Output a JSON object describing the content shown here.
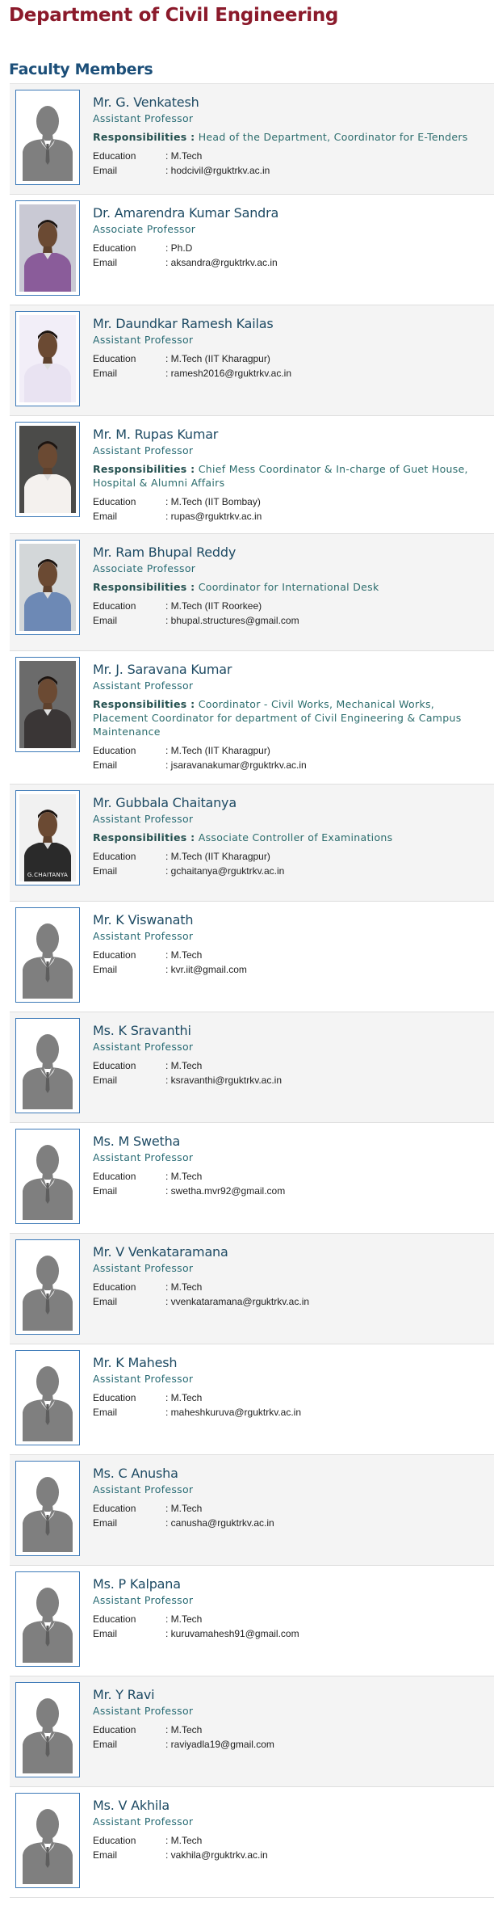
{
  "header": {
    "department_title": "Department of Civil Engineering"
  },
  "section": {
    "title": "Faculty Members"
  },
  "labels": {
    "education": "Education",
    "email": "Email",
    "responsibilities": "Responsibilities :"
  },
  "faculty": [
    {
      "name": "Mr. G. Venkatesh",
      "designation": "Assistant Professor",
      "responsibilities": "Head of the Department, Coordinator for E-Tenders",
      "education": ": M.Tech",
      "email": ": hodcivil@rguktrkv.ac.in",
      "photo": "placeholder-avatar"
    },
    {
      "name": "Dr. Amarendra Kumar Sandra",
      "designation": "Associate Professor",
      "responsibilities": "",
      "education": ": Ph.D",
      "email": ": aksandra@rguktrkv.ac.in",
      "photo": "portrait-photo"
    },
    {
      "name": "Mr. Daundkar Ramesh Kailas",
      "designation": "Assistant Professor",
      "responsibilities": "",
      "education": ": M.Tech (IIT Kharagpur)",
      "email": ": ramesh2016@rguktrkv.ac.in",
      "photo": "portrait-photo"
    },
    {
      "name": "Mr. M. Rupas Kumar",
      "designation": "Assistant Professor",
      "responsibilities": "Chief Mess Coordinator & In-charge of Guet House, Hospital & Alumni Affairs",
      "education": ": M.Tech (IIT Bombay)",
      "email": ": rupas@rguktrkv.ac.in",
      "photo": "portrait-photo"
    },
    {
      "name": "Mr. Ram Bhupal Reddy",
      "designation": "Associate Professor",
      "responsibilities": "Coordinator for International Desk",
      "education": ": M.Tech (IIT Roorkee)",
      "email": ": bhupal.structures@gmail.com",
      "photo": "portrait-photo"
    },
    {
      "name": "Mr. J. Saravana Kumar",
      "designation": "Assistant Professor",
      "responsibilities": "Coordinator - Civil Works, Mechanical Works, Placement Coordinator for department of Civil Engineering & Campus Maintenance",
      "education": ": M.Tech (IIT Kharagpur)",
      "email": ": jsaravanakumar@rguktrkv.ac.in",
      "photo": "portrait-photo"
    },
    {
      "name": "Mr. Gubbala Chaitanya",
      "designation": "Assistant Professor",
      "responsibilities": "Associate Controller of Examinations",
      "education": ": M.Tech (IIT Kharagpur)",
      "email": ": gchaitanya@rguktrkv.ac.in",
      "photo": "portrait-photo",
      "photo_caption": "G.CHAITANYA"
    },
    {
      "name": "Mr. K Viswanath",
      "designation": "Assistant Professor",
      "responsibilities": "",
      "education": ": M.Tech",
      "email": ": kvr.iit@gmail.com",
      "photo": "placeholder-avatar"
    },
    {
      "name": "Ms. K Sravanthi",
      "designation": "Assistant Professor",
      "responsibilities": "",
      "education": ": M.Tech",
      "email": ": ksravanthi@rguktrkv.ac.in",
      "photo": "placeholder-avatar"
    },
    {
      "name": "Ms. M Swetha",
      "designation": "Assistant Professor",
      "responsibilities": "",
      "education": ": M.Tech",
      "email": ": swetha.mvr92@gmail.com",
      "photo": "placeholder-avatar"
    },
    {
      "name": "Mr. V Venkataramana",
      "designation": "Assistant Professor",
      "responsibilities": "",
      "education": ": M.Tech",
      "email": ": vvenkataramana@rguktrkv.ac.in",
      "photo": "placeholder-avatar"
    },
    {
      "name": "Mr. K Mahesh",
      "designation": "Assistant Professor",
      "responsibilities": "",
      "education": ": M.Tech",
      "email": ": maheshkuruva@rguktrkv.ac.in",
      "photo": "placeholder-avatar"
    },
    {
      "name": "Ms. C Anusha",
      "designation": "Assistant Professor",
      "responsibilities": "",
      "education": ": M.Tech",
      "email": ": canusha@rguktrkv.ac.in",
      "photo": "placeholder-avatar"
    },
    {
      "name": "Ms. P Kalpana",
      "designation": "Assistant Professor",
      "responsibilities": "",
      "education": ": M.Tech",
      "email": ": kuruvamahesh91@gmail.com",
      "photo": "placeholder-avatar"
    },
    {
      "name": "Mr. Y Ravi",
      "designation": "Assistant Professor",
      "responsibilities": "",
      "education": ": M.Tech",
      "email": ": raviyadla19@gmail.com",
      "photo": "placeholder-avatar"
    },
    {
      "name": "Ms. V Akhila",
      "designation": "Assistant Professor",
      "responsibilities": "",
      "education": ": M.Tech",
      "email": ": vakhila@rguktrkv.ac.in",
      "photo": "placeholder-avatar"
    }
  ],
  "colors": {
    "title": "#8b1a2b",
    "section": "#1c4f79",
    "name": "#1d4a63",
    "designation": "#286b74",
    "photo_border": "#3d7ab8",
    "alt_row": "#f4f4f4",
    "avatar": "#7f7f7f"
  }
}
